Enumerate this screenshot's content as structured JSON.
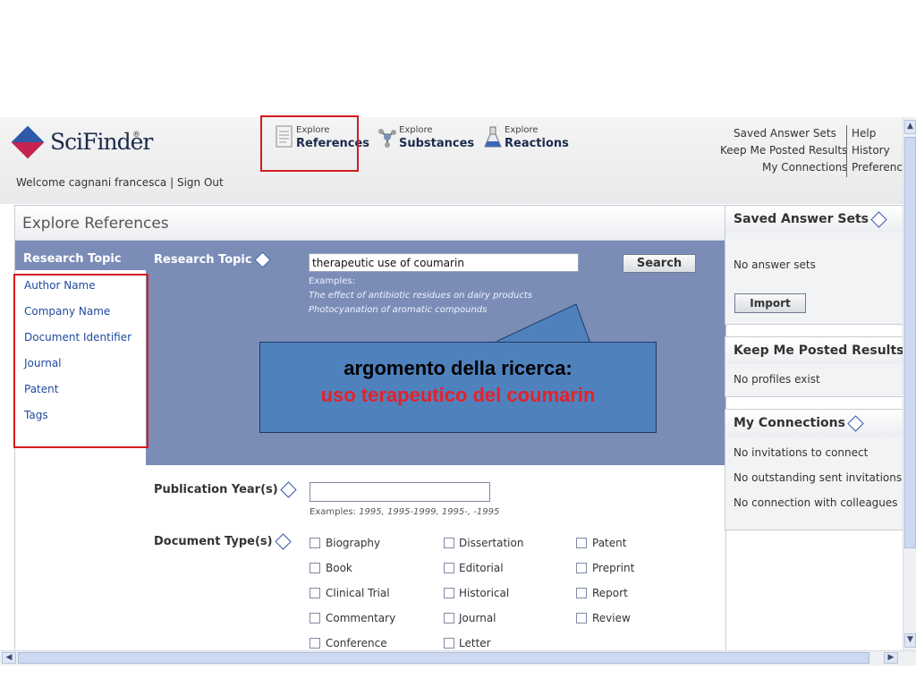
{
  "app": {
    "brand": "SciFinder",
    "registered": "®",
    "welcome": "Welcome cagnani francesca",
    "sign_out": "Sign Out"
  },
  "nav": {
    "references": {
      "small": "Explore",
      "big": "References"
    },
    "substances": {
      "small": "Explore",
      "big": "Substances"
    },
    "reactions": {
      "small": "Explore",
      "big": "Reactions"
    }
  },
  "top_links": {
    "saved_answer_sets": "Saved Answer Sets",
    "keep_me_posted": "Keep Me Posted Results",
    "my_connections": "My Connections",
    "help": "Help",
    "history": "History",
    "preferences": "Preferences"
  },
  "page_title": "Explore References",
  "left_nav": {
    "active": "Research Topic",
    "items": [
      "Author Name",
      "Company Name",
      "Document Identifier",
      "Journal",
      "Patent",
      "Tags"
    ]
  },
  "form": {
    "research_topic_label": "Research Topic",
    "research_topic_value": "therapeutic use of coumarin",
    "search_button": "Search",
    "examples_label": "Examples:",
    "example_1": "The effect of antibiotic residues on dairy products",
    "example_2": "Photocyanation of aromatic compounds",
    "pub_year_label": "Publication Year(s)",
    "pub_year_value": "",
    "pub_year_examples_label": "Examples:",
    "pub_year_examples": "1995, 1995-1999, 1995-, -1995",
    "doc_type_label": "Document Type(s)",
    "doc_types": {
      "col1": [
        "Biography",
        "Book",
        "Clinical Trial",
        "Commentary",
        "Conference"
      ],
      "col2": [
        "Dissertation",
        "Editorial",
        "Historical",
        "Journal",
        "Letter"
      ],
      "col3": [
        "Patent",
        "Preprint",
        "Report",
        "Review"
      ]
    }
  },
  "callout": {
    "line1": "argomento della ricerca:",
    "line2": "uso terapeutico del coumarin"
  },
  "sidebar": {
    "saved_answer_sets": {
      "title": "Saved Answer Sets",
      "text": "No answer sets",
      "button": "Import"
    },
    "keep_me_posted": {
      "title": "Keep Me Posted Results",
      "text": "No profiles exist"
    },
    "my_connections": {
      "title": "My Connections",
      "lines": [
        "No invitations to connect",
        "No outstanding sent invitations",
        "No connection with colleagues"
      ]
    }
  },
  "colors": {
    "form_blue": "#7b8db7",
    "highlight_red": "#d41c1c",
    "callout_blue": "#4f81bd",
    "callout_red_text": "#e4222a",
    "link_blue": "#1f4aa0"
  }
}
